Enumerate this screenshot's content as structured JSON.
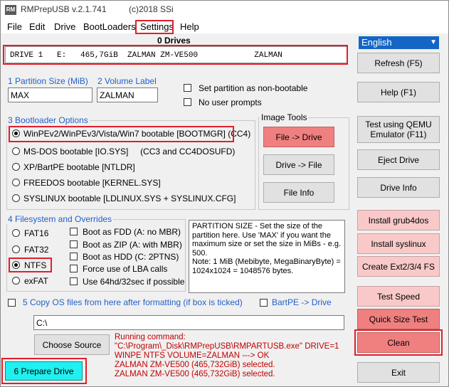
{
  "window": {
    "app_icon": "RM",
    "title": "RMPrepUSB v.2.1.741",
    "copyright": "(c)2018 SSi"
  },
  "menu": {
    "file": "File",
    "edit": "Edit",
    "drive": "Drive",
    "bootloaders": "BootLoaders",
    "settings": "Settings",
    "help": "Help"
  },
  "drives": {
    "count_label": "0 Drives",
    "selected": "DRIVE 1   E:   465,7GiB  ZALMAN ZM-VE500            ZALMAN"
  },
  "language": {
    "selected": "English"
  },
  "partition": {
    "size_label": "1 Partition Size (MiB)",
    "size_value": "MAX",
    "volume_label": "2 Volume Label",
    "volume_value": "ZALMAN",
    "non_bootable_label": "Set partition as non-bootable",
    "no_prompts_label": "No user prompts"
  },
  "bootloader": {
    "group_label": "3 Bootloader Options",
    "options": [
      "WinPEv2/WinPEv3/Vista/Win7 bootable [BOOTMGR] (CC4)",
      "MS-DOS bootable [IO.SYS]     (CC3 and CC4DOSUFD)",
      "XP/BartPE bootable [NTLDR]",
      "FREEDOS bootable [KERNEL.SYS]",
      "SYSLINUX bootable [LDLINUX.SYS + SYSLINUX.CFG]"
    ]
  },
  "image_tools": {
    "label": "Image Tools",
    "file_to_drive": "File -> Drive",
    "drive_to_file": "Drive -> File",
    "file_info": "File Info"
  },
  "filesystem": {
    "group_label": "4 Filesystem and Overrides",
    "types": [
      "FAT16",
      "FAT32",
      "NTFS",
      "exFAT"
    ],
    "overrides": [
      "Boot as FDD (A: no MBR)",
      "Boot as ZIP (A: with MBR)",
      "Boot as HDD (C: 2PTNS)",
      "Force use of LBA calls",
      "Use 64hd/32sec if possible"
    ]
  },
  "help_text": "PARTITION SIZE - Set the size of the partition here. Use 'MAX' if you want the maximum size or set the size in MiBs - e.g. 500.\nNote: 1 MiB (Mebibyte, MegaBinaryByte) = 1024x1024 = 1048576 bytes.",
  "copy_os": {
    "label": "5 Copy OS files from here after formatting (if box is ticked)",
    "path": "C:\\",
    "bartpe_label": "BartPE -> Drive"
  },
  "buttons": {
    "refresh": "Refresh (F5)",
    "help": "Help (F1)",
    "test_qemu_line1": "Test using QEMU",
    "test_qemu_line2": "Emulator (F11)",
    "eject": "Eject Drive",
    "drive_info": "Drive Info",
    "grub4dos": "Install grub4dos",
    "syslinux": "Install syslinux",
    "ext": "Create Ext2/3/4 FS",
    "test_speed": "Test Speed",
    "quick_size": "Quick Size Test",
    "clean": "Clean",
    "exit": "Exit",
    "choose_source": "Choose Source",
    "prepare": "6 Prepare Drive"
  },
  "log": "Running command:\n\"C:\\Program\\_Disk\\RMPrepUSB\\RMPARTUSB.exe\" DRIVE=1\nWINPE NTFS VOLUME=ZALMAN ---> OK\nZALMAN ZM-VE500 (465,732GiB) selected.\nZALMAN ZM-VE500 (465,732GiB) selected.",
  "colors": {
    "highlight_box": "#e0202b",
    "language_bg": "#1466c6",
    "pink_button": "#f9c9c9",
    "red_button": "#f08080",
    "prepare_button": "#20f0f0",
    "log_text": "#c00000"
  }
}
